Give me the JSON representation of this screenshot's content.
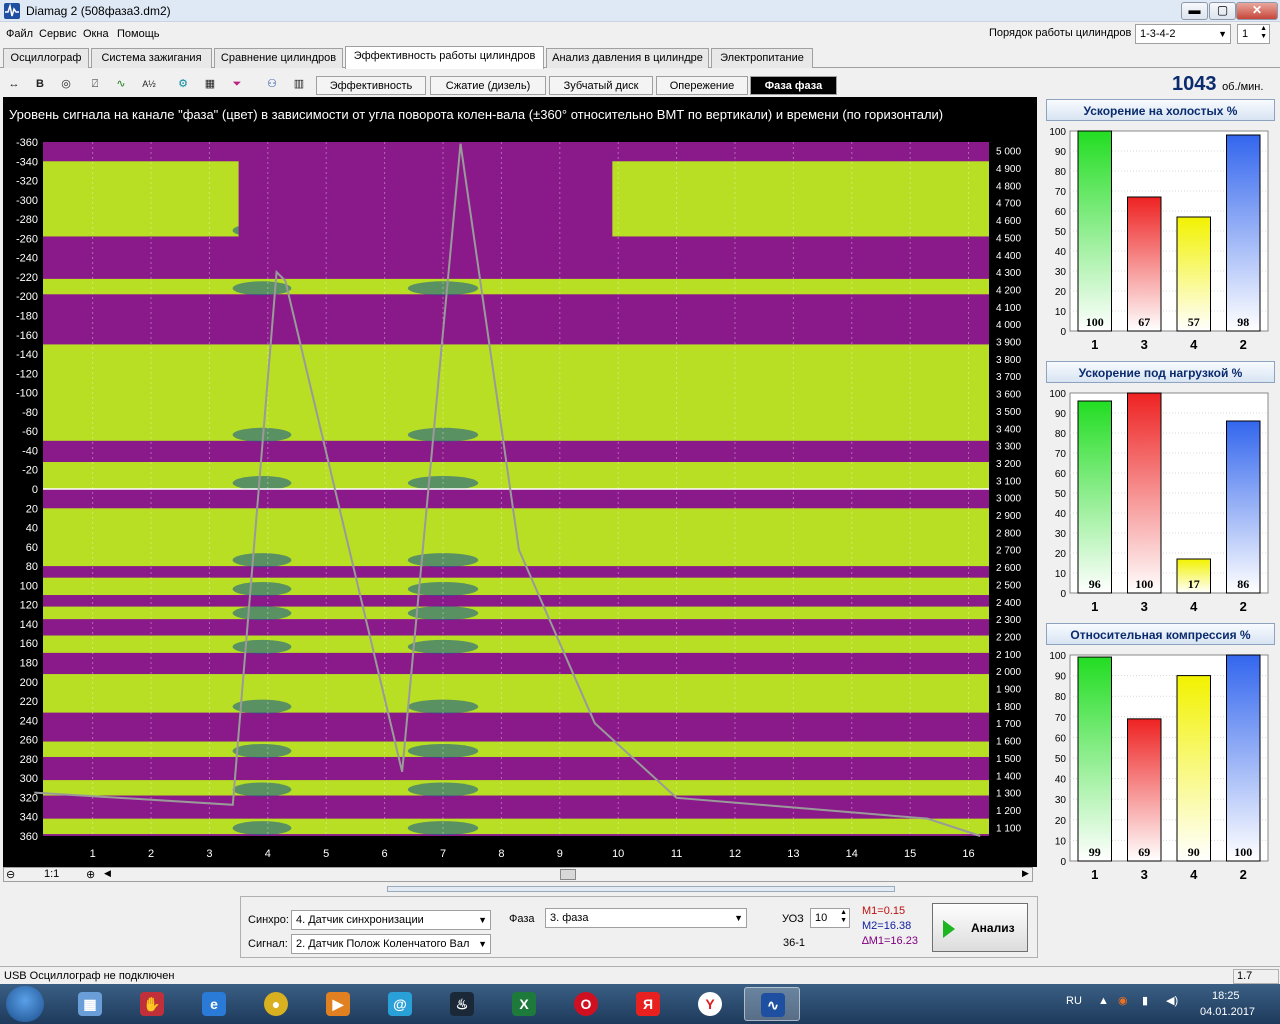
{
  "window": {
    "title": "Diamag 2 (508фаза3.dm2)",
    "min": "▬",
    "max": "▢",
    "close": "✕"
  },
  "menu": [
    "Файл",
    "Сервис",
    "Окна",
    "Помощь"
  ],
  "firing_order": {
    "label": "Порядок работы цилиндров",
    "value": "1-3-4-2",
    "spin_value": "1"
  },
  "main_tabs": [
    "Осциллограф",
    "Система зажигания",
    "Сравнение цилиндров",
    "Эффективность работы цилиндров",
    "Анализ давления в цилиндре",
    "Электропитание"
  ],
  "sub_tabs": [
    "Эффективность",
    "Сжатие (дизель)",
    "Зубчатый диск",
    "Опережение",
    "Фаза фаза"
  ],
  "rpm": {
    "value": "1043",
    "unit": "об./мин."
  },
  "chart_data": {
    "type": "heatmap",
    "title": "Уровень сигнала на канале \"фаза\" (цвет) в зависимости от угла поворота колен-вала (±360° относительно ВМТ по вертикали) и времени (по горизонтали)",
    "y_left_ticks": [
      "-360",
      "-340",
      "-320",
      "-300",
      "-280",
      "-260",
      "-240",
      "-220",
      "-200",
      "-180",
      "-160",
      "-140",
      "-120",
      "-100",
      "-80",
      "-60",
      "-40",
      "-20",
      "0",
      "20",
      "40",
      "60",
      "80",
      "100",
      "120",
      "140",
      "160",
      "180",
      "200",
      "220",
      "240",
      "260",
      "280",
      "300",
      "320",
      "340",
      "360"
    ],
    "y_right_ticks": [
      "5 000",
      "4 900",
      "4 800",
      "4 700",
      "4 600",
      "4 500",
      "4 400",
      "4 300",
      "4 200",
      "4 100",
      "4 000",
      "3 900",
      "3 800",
      "3 700",
      "3 600",
      "3 500",
      "3 400",
      "3 300",
      "3 200",
      "3 100",
      "3 000",
      "2 900",
      "2 800",
      "2 700",
      "2 600",
      "2 500",
      "2 400",
      "2 300",
      "2 200",
      "2 100",
      "2 000",
      "1 900",
      "1 800",
      "1 700",
      "1 600",
      "1 500",
      "1 400",
      "1 300",
      "1 200",
      "1 100"
    ],
    "x_ticks": [
      "1",
      "2",
      "3",
      "4",
      "5",
      "6",
      "7",
      "8",
      "9",
      "10",
      "11",
      "12",
      "13",
      "14",
      "15",
      "16"
    ],
    "colors": {
      "low": "#8a1a8a",
      "high": "#b8df23",
      "edge": "#1b5e8c",
      "rpm_line": "#9a9a9a"
    }
  },
  "zoom_label": "1:1",
  "charts": [
    {
      "title": "Ускорение на холостых %",
      "ticks": [
        "100",
        "90",
        "80",
        "70",
        "60",
        "50",
        "40",
        "30",
        "20",
        "10",
        "0"
      ],
      "bars": [
        {
          "cyl": "1",
          "value": 100,
          "label": "100",
          "color": "#22dd22"
        },
        {
          "cyl": "3",
          "value": 67,
          "label": "67",
          "color": "#ee2222"
        },
        {
          "cyl": "4",
          "value": 57,
          "label": "57",
          "color": "#f2f200"
        },
        {
          "cyl": "2",
          "value": 98,
          "label": "98",
          "color": "#3366ee"
        }
      ]
    },
    {
      "title": "Ускорение под нагрузкой %",
      "ticks": [
        "100",
        "90",
        "80",
        "70",
        "60",
        "50",
        "40",
        "30",
        "20",
        "10",
        "0"
      ],
      "bars": [
        {
          "cyl": "1",
          "value": 96,
          "label": "96",
          "color": "#22dd22"
        },
        {
          "cyl": "3",
          "value": 100,
          "label": "100",
          "color": "#ee2222"
        },
        {
          "cyl": "4",
          "value": 17,
          "label": "17",
          "color": "#f2f200"
        },
        {
          "cyl": "2",
          "value": 86,
          "label": "86",
          "color": "#3366ee"
        }
      ]
    },
    {
      "title": "Относительная компрессия %",
      "ticks": [
        "100",
        "90",
        "80",
        "70",
        "60",
        "50",
        "40",
        "30",
        "20",
        "10",
        "0"
      ],
      "bars": [
        {
          "cyl": "1",
          "value": 99,
          "label": "99",
          "color": "#22dd22"
        },
        {
          "cyl": "3",
          "value": 69,
          "label": "69",
          "color": "#ee2222"
        },
        {
          "cyl": "4",
          "value": 90,
          "label": "90",
          "color": "#f2f200"
        },
        {
          "cyl": "2",
          "value": 100,
          "label": "100",
          "color": "#3366ee"
        }
      ]
    }
  ],
  "bottom": {
    "sync_label": "Синхро:",
    "sync_value": "4. Датчик синхронизации",
    "signal_label": "Сигнал:",
    "signal_value": "2. Датчик Полож Коленчатого Вал",
    "phase_label": "Фаза",
    "phase_value": "3. фаза",
    "uoz_label": "УОЗ",
    "uoz_value": "10",
    "teeth": "36-1",
    "m1": "M1=0.15",
    "m2": "M2=16.38",
    "dm": "∆M1=16.23",
    "analyze": "Анализ"
  },
  "status": {
    "left": "USB Осциллограф не подключен",
    "right": "1.7"
  },
  "taskbar": {
    "lang": "RU",
    "time": "18:25",
    "date": "04.01.2017"
  }
}
